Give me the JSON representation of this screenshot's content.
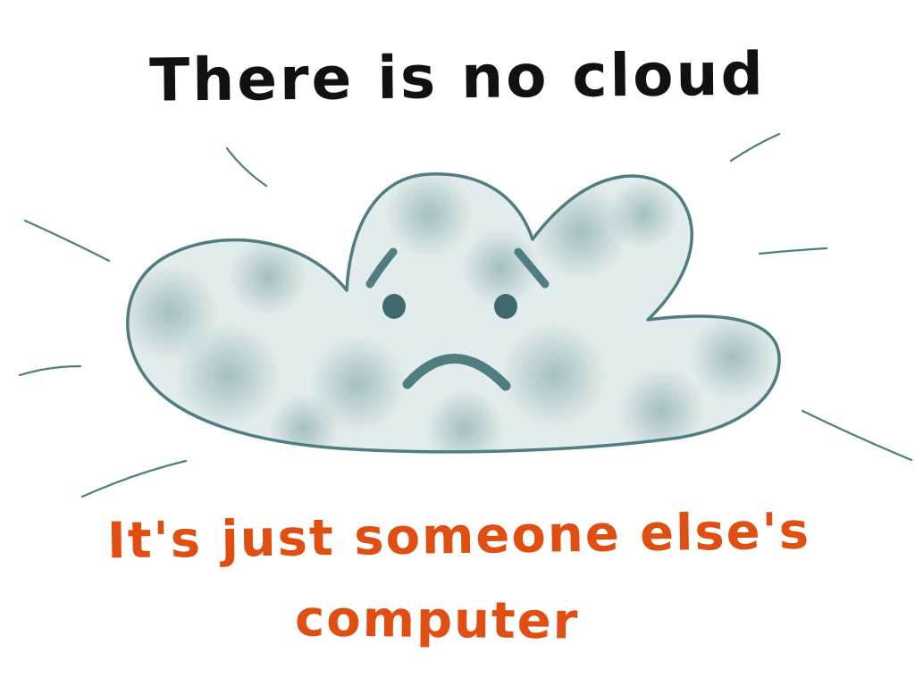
{
  "headline": {
    "text": "There is  no  cloud",
    "color": "#111111"
  },
  "caption": {
    "line1": "It's just someone else's",
    "line2": "computer",
    "color": "#e04e12"
  },
  "cloud": {
    "mood": "sad",
    "outline_color": "#4f7d80",
    "fill_color": "#c9d9da"
  }
}
